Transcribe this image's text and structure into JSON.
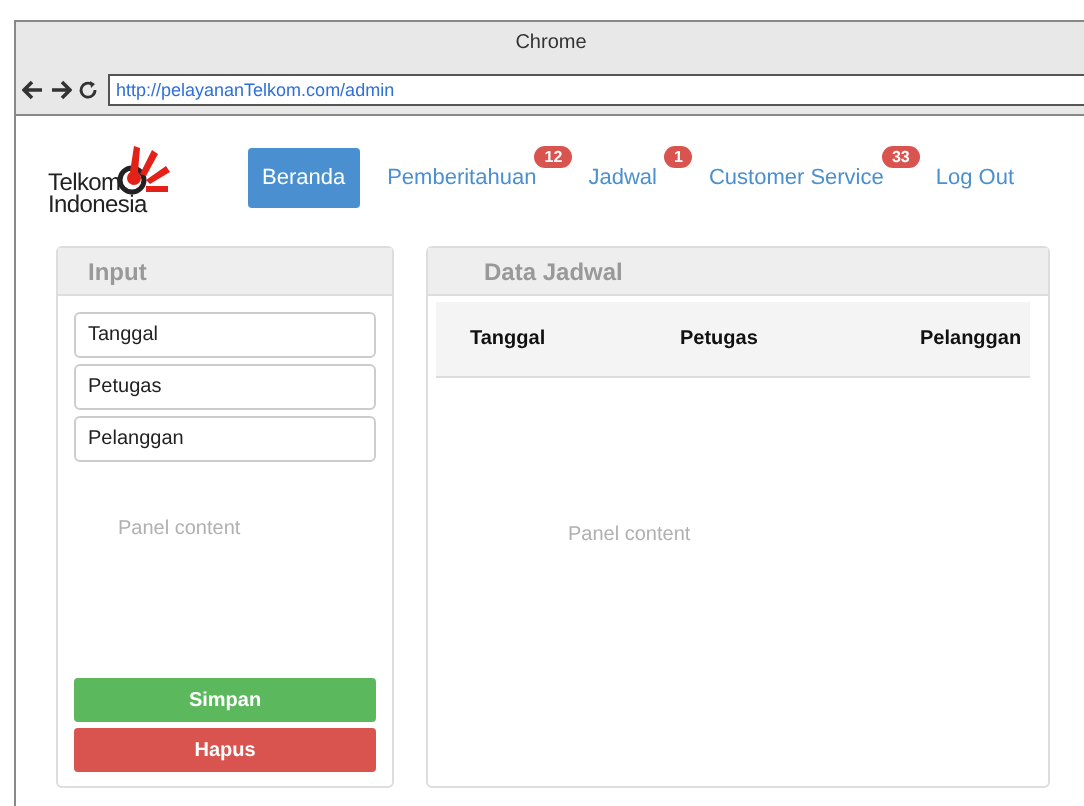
{
  "window": {
    "title": "Chrome",
    "url": "http://pelayananTelkom.com/admin"
  },
  "logo": {
    "line_1": "Telkom",
    "line_2": "Indonesia"
  },
  "nav": [
    {
      "label": "Beranda",
      "selected": true
    },
    {
      "label": "Pemberitahuan",
      "selected": false,
      "badge": "12"
    },
    {
      "label": "Jadwal",
      "selected": false,
      "badge": "1"
    },
    {
      "label": "Customer Service",
      "selected": false,
      "badge": "33"
    },
    {
      "label": "Log Out",
      "selected": false
    }
  ],
  "input_panel": {
    "title": "Input",
    "fields": [
      {
        "value": "Tanggal"
      },
      {
        "value": "Petugas"
      },
      {
        "value": "Pelanggan"
      }
    ],
    "content": "Panel content",
    "buttons": [
      {
        "label": "Simpan",
        "kind": "success"
      },
      {
        "label": "Hapus",
        "kind": "danger"
      }
    ]
  },
  "data_panel": {
    "title": "Data Jadwal",
    "columns": [
      "Tanggal",
      "Petugas",
      "Pelanggan"
    ],
    "content": "Panel content"
  }
}
